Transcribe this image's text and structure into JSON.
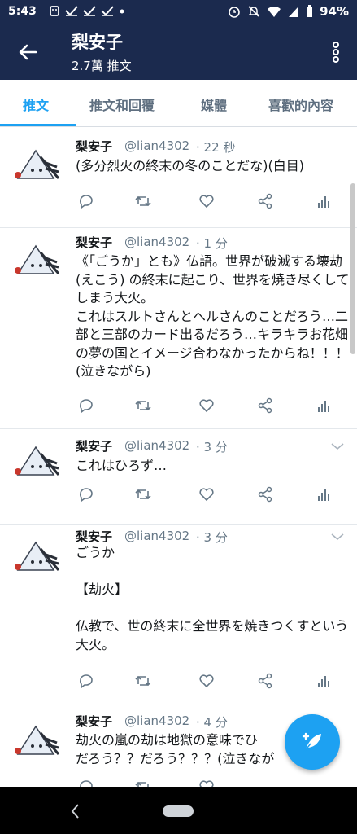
{
  "status_bar": {
    "time": "5:43",
    "battery": "94%",
    "left_icons": [
      "android-icon",
      "check-icon",
      "check-icon",
      "check-icon",
      "dot-icon"
    ],
    "right_icons": [
      "alarm-icon",
      "mute-icon",
      "wifi-icon",
      "signal-icon",
      "battery-icon"
    ]
  },
  "header": {
    "title": "梨安子",
    "subtitle": "2.7萬 推文"
  },
  "tabs": [
    {
      "label": "推文",
      "active": true
    },
    {
      "label": "推文和回覆",
      "active": false
    },
    {
      "label": "媒體",
      "active": false
    },
    {
      "label": "喜歡的內容",
      "active": false
    }
  ],
  "colors": {
    "header_bg": "#1b2a4e",
    "accent": "#1da1f2",
    "text_primary": "#14171a",
    "text_secondary": "#657786"
  },
  "tweets": [
    {
      "name": "梨安子",
      "handle": "@lian4302",
      "time": "· 22 秒",
      "text": "(多分烈火の終末の冬のことだな)(白目)"
    },
    {
      "name": "梨安子",
      "handle": "@lian4302",
      "time": "· 1 分",
      "text": "《「ごうか」とも》仏語。世界が破滅する壊劫 (えこう) の終末に起こり、世界を焼き尽くしてしまう大火。\nこれはスルトさんとヘルさんのことだろう…二部と三部のカード出るだろう…キラキラお花畑の夢の国とイメージ合わなかったからね！！！(泣きながら)"
    },
    {
      "name": "梨安子",
      "handle": "@lian4302",
      "time": "· 3 分",
      "text": "これはひろず…"
    },
    {
      "name": "梨安子",
      "handle": "@lian4302",
      "time": "· 3 分",
      "text": "ごうか\n\n【劫火】\n\n仏教で、世の終末に全世界を焼きつくすという大火。"
    },
    {
      "name": "梨安子",
      "handle": "@lian4302",
      "time": "· 4 分",
      "text": "劫火の嵐の劫は地獄の意味でひ\nだろう？？だろう？？？(泣きなが"
    }
  ]
}
